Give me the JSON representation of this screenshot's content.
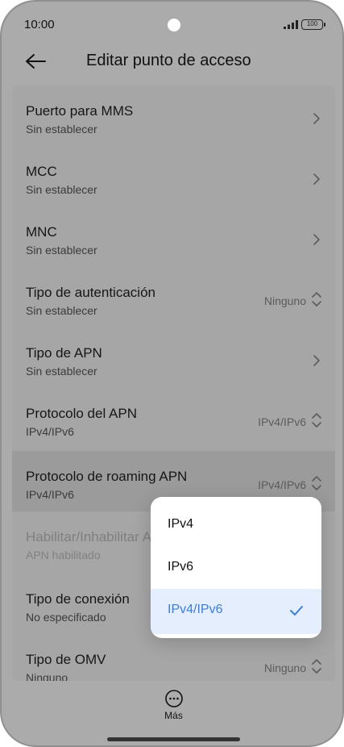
{
  "status": {
    "time": "10:00",
    "battery": "100"
  },
  "header": {
    "title": "Editar punto de acceso"
  },
  "items": [
    {
      "title": "Puerto para MMS",
      "subtitle": "Sin establecer",
      "value": "",
      "control": "chevron"
    },
    {
      "title": "MCC",
      "subtitle": "Sin establecer",
      "value": "",
      "control": "chevron"
    },
    {
      "title": "MNC",
      "subtitle": "Sin establecer",
      "value": "",
      "control": "chevron"
    },
    {
      "title": "Tipo de autenticación",
      "subtitle": "Sin establecer",
      "value": "Ninguno",
      "control": "updown"
    },
    {
      "title": "Tipo de APN",
      "subtitle": "Sin establecer",
      "value": "",
      "control": "chevron"
    },
    {
      "title": "Protocolo del APN",
      "subtitle": "IPv4/IPv6",
      "value": "IPv4/IPv6",
      "control": "updown"
    },
    {
      "title": "Protocolo de roaming APN",
      "subtitle": "IPv4/IPv6",
      "value": "IPv4/IPv6",
      "control": "updown"
    },
    {
      "title": "Habilitar/Inhabilitar APN",
      "subtitle": "APN habilitado",
      "value": "",
      "control": "none"
    },
    {
      "title": "Tipo de conexión",
      "subtitle": "No especificado",
      "value": "",
      "control": "none"
    },
    {
      "title": "Tipo de OMV",
      "subtitle": "Ninguno",
      "value": "Ninguno",
      "control": "updown"
    }
  ],
  "dropdown": {
    "options": [
      {
        "label": "IPv4",
        "selected": false
      },
      {
        "label": "IPv6",
        "selected": false
      },
      {
        "label": "IPv4/IPv6",
        "selected": true
      }
    ]
  },
  "bottom": {
    "more_label": "Más"
  },
  "icons": {
    "back": "back-arrow-icon",
    "more": "more-dots-icon",
    "check": "check-icon",
    "chevron": "chevron-right-icon",
    "updown": "up-down-icon"
  },
  "colors": {
    "accent": "#3d7fd6",
    "selected_bg": "#e5eefc"
  }
}
